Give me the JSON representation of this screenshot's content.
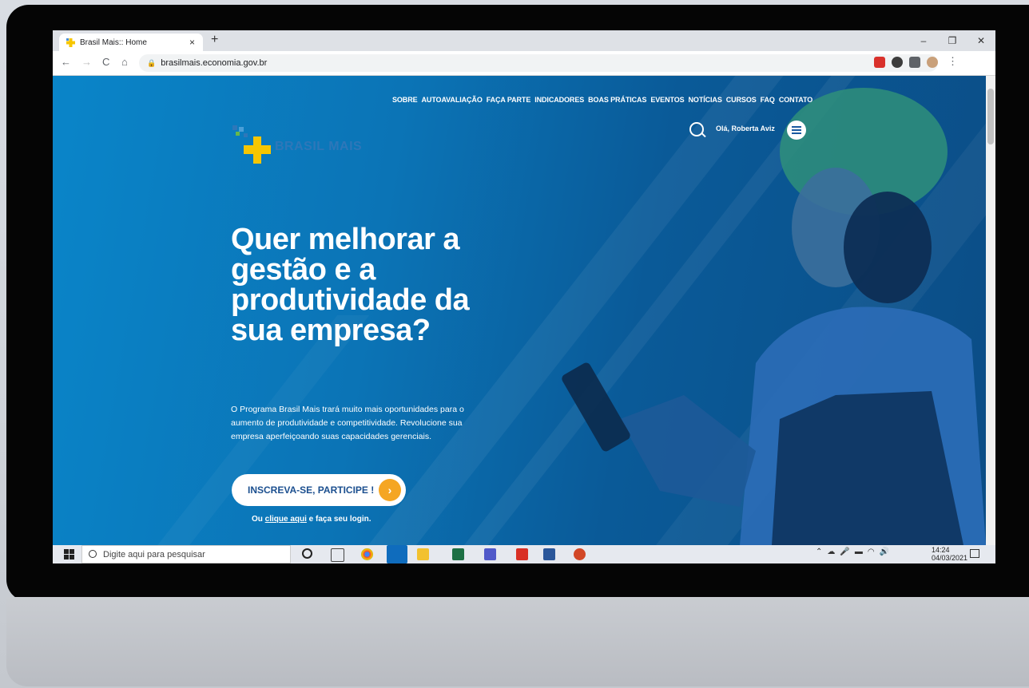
{
  "browser": {
    "tab_title": "Brasil Mais:: Home",
    "tab_close": "×",
    "new_tab": "+",
    "window_controls": [
      "–",
      "❐",
      "✕"
    ],
    "url": "brasilmais.economia.gov.br",
    "nav": {
      "back": "←",
      "forward": "→",
      "reload": "C",
      "home": "⌂"
    }
  },
  "site": {
    "nav_items": [
      "SOBRE",
      "AUTOAVALIAÇÃO",
      "FAÇA PARTE",
      "INDICADORES",
      "BOAS PRÁTICAS",
      "EVENTOS",
      "NOTÍCIAS",
      "CURSOS",
      "FAQ",
      "CONTATO"
    ],
    "logo_text": "BRASIL MAIS",
    "greeting": "Olá, Roberta Aviz",
    "headline": "Quer melhorar a gestão e a produtividade da sua empresa?",
    "description": "O Programa Brasil Mais trará muito mais oportunidades para o aumento de produtividade e competitividade. Revolucione sua empresa aperfeiçoando suas capacidades gerenciais.",
    "cta_label": "INSCREVA-SE, PARTICIPE !",
    "login_prefix": "Ou ",
    "login_link": "clique aqui",
    "login_suffix": " e faça seu login."
  },
  "taskbar": {
    "search_placeholder": "Digite aqui para pesquisar",
    "time": "14:24",
    "date": "04/03/2021"
  },
  "colors": {
    "hero_blue": "#0a85c9",
    "cta_orange": "#f5a623",
    "logo_yellow": "#f7c600"
  }
}
